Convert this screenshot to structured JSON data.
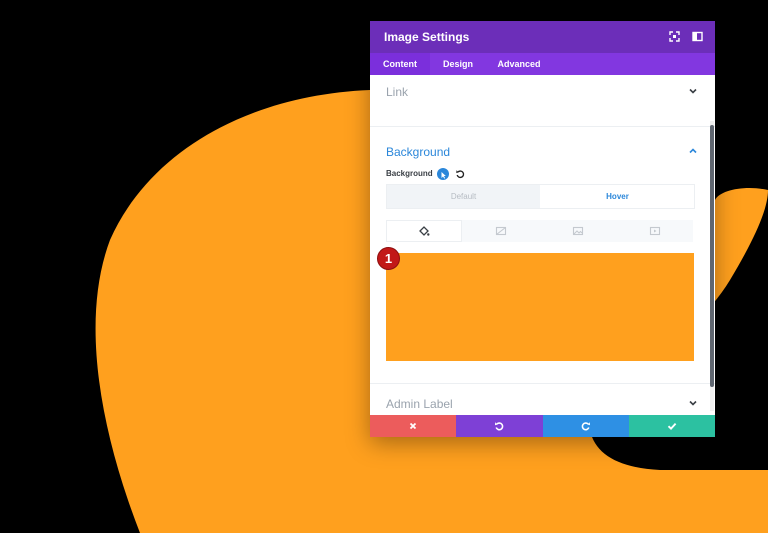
{
  "panel": {
    "title": "Image Settings",
    "header_icons": [
      "expand-icon",
      "sidebar-toggle-icon"
    ],
    "tabs": [
      {
        "label": "Content",
        "active": true
      },
      {
        "label": "Design",
        "active": false
      },
      {
        "label": "Advanced",
        "active": false
      }
    ]
  },
  "sections": {
    "link": {
      "title": "Link",
      "expanded": false
    },
    "background": {
      "title": "Background",
      "expanded": true,
      "field_label": "Background",
      "state_toggle": {
        "default_label": "Default",
        "hover_label": "Hover",
        "selected": "Hover"
      },
      "background_types": [
        "paint-bucket-icon",
        "gradient-icon",
        "image-icon",
        "video-icon"
      ],
      "color_value": "#ffa01e"
    },
    "admin_label": {
      "title": "Admin Label",
      "expanded": false
    }
  },
  "annotation_marker": "1",
  "footer": {
    "buttons": [
      {
        "icon": "close-icon",
        "color": "#ec5c5c"
      },
      {
        "icon": "undo-icon",
        "color": "#7e40d6"
      },
      {
        "icon": "redo-icon",
        "color": "#2e90e4"
      },
      {
        "icon": "check-icon",
        "color": "#2cc1a1"
      }
    ]
  },
  "colors": {
    "accent_purple": "#6c2eb9",
    "tab_bar_purple": "#8237e0",
    "link_blue": "#2b87da",
    "shape_orange": "#ffa01e",
    "background": "#000000"
  }
}
